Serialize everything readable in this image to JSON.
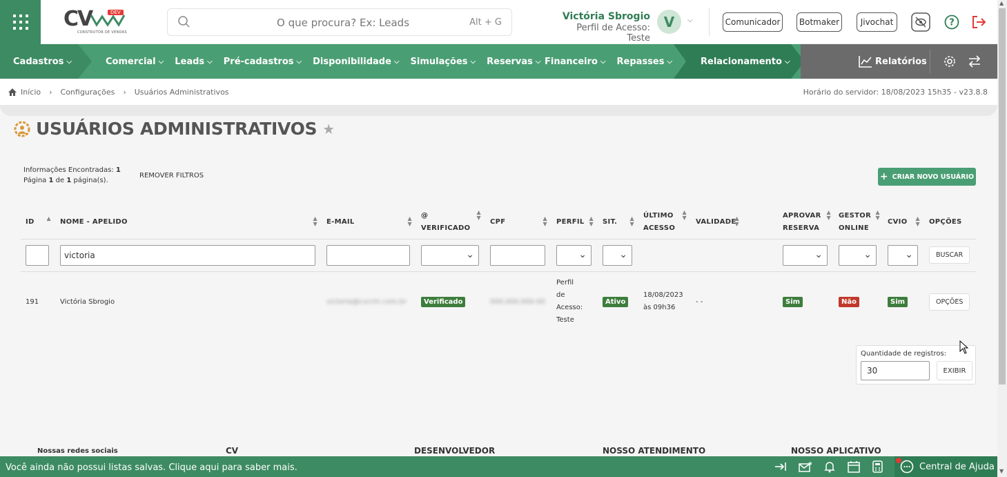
{
  "header": {
    "logo_text": "CV",
    "logo_badge": "DEV",
    "logo_sub": "CONSTRUTOR DE VENDAS",
    "search_placeholder": "O que procura? Ex: Leads",
    "search_shortcut": "Alt + G",
    "user_name": "Victória Sbrogio",
    "user_profile": "Perfil de Acesso: Teste",
    "avatar_letter": "V",
    "buttons": [
      "Comunicador",
      "Botmaker",
      "Jivochat"
    ]
  },
  "nav": {
    "cadastros": "Cadastros",
    "items": [
      "Comercial",
      "Leads",
      "Pré-cadastros",
      "Disponibilidade",
      "Simulações",
      "Reservas"
    ],
    "items2": [
      "Financeiro",
      "Repasses"
    ],
    "relacionamento": "Relacionamento",
    "relatorios": "Relatórios"
  },
  "breadcrumb": {
    "items": [
      "Início",
      "Configurações",
      "Usuários Administrativos"
    ],
    "server_time": "Horário do servidor: 18/08/2023 15h35 - v23.8.8"
  },
  "page": {
    "title": "USUÁRIOS ADMINISTRATIVOS",
    "info_found_label": "Informações Encontradas:",
    "info_found_value": "1",
    "page_label_1": "Página",
    "page_value": "1",
    "page_label_2": "de",
    "page_total": "1",
    "page_label_3": "página(s).",
    "remove_filters": "REMOVER FILTROS",
    "create_button": "CRIAR NOVO USUÁRIO"
  },
  "table": {
    "headers": {
      "id": "ID",
      "nome": "NOME - APELIDO",
      "email": "E-MAIL",
      "verificado_1": "@",
      "verificado_2": "VERIFICADO",
      "cpf": "CPF",
      "perfil": "PERFIL",
      "sit": "SIT.",
      "ultimo_1": "ÚLTIMO",
      "ultimo_2": "ACESSO",
      "validade": "VALIDADE",
      "aprovar_1": "APROVAR",
      "aprovar_2": "RESERVA",
      "gestor_1": "GESTOR",
      "gestor_2": "ONLINE",
      "cvio": "CVIO",
      "opcoes": "OPÇÕES"
    },
    "filter": {
      "id_value": "",
      "nome_value": "victoria",
      "buscar": "BUSCAR"
    },
    "rows": [
      {
        "id": "191",
        "nome": "Victória Sbrogio",
        "email": "victoria@cvcrm.com.br",
        "verificado": "Verificado",
        "cpf": "000.000.000-00",
        "perfil_1": "Perfil",
        "perfil_2": "de",
        "perfil_3": "Acesso:",
        "perfil_4": "Teste",
        "sit": "Ativo",
        "ultimo_1": "18/08/2023",
        "ultimo_2": "às 09h36",
        "validade": "- -",
        "aprovar": "Sim",
        "gestor": "Não",
        "cvio": "Sim",
        "opcoes": "OPÇÕES"
      }
    ]
  },
  "quantity": {
    "label": "Quantidade de registros:",
    "value": "30",
    "button": "EXIBIR"
  },
  "footer": {
    "redes": "Nossas redes sociais",
    "cv": "CV",
    "dev": "DESENVOLVEDOR",
    "atend": "NOSSO ATENDIMENTO",
    "app": "NOSSO APLICATIVO"
  },
  "bottom": {
    "text": "Você ainda não possui listas salvas. Clique aqui para saber mais.",
    "help": "Central de Ajuda"
  },
  "colors": {
    "brand_green": "#4a9e73",
    "dark_green": "#2f7d55",
    "badge_red": "#c0392b",
    "badge_green": "#3d7d3d"
  }
}
